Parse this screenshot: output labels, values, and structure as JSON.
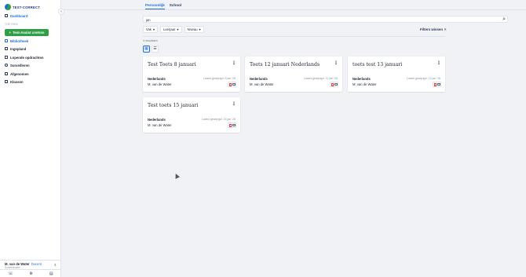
{
  "app": {
    "logo_text": "TEST-CORRECT"
  },
  "sidebar": {
    "collapse_label": "‹",
    "dashboard": "Dashboard",
    "section_label": "TOETSEN",
    "create_button": "Test-Assist creëren",
    "items": [
      {
        "label": "Bibliotheek"
      },
      {
        "label": "Ingepland"
      },
      {
        "label": "Lopende opdrachten"
      },
      {
        "label": "Surveilleren"
      },
      {
        "label": "Afgenomen"
      },
      {
        "label": "Klassen"
      }
    ],
    "user": {
      "name": "M. van de Water",
      "role": "Docent",
      "school": "Scholennaam"
    }
  },
  "tabs": [
    {
      "label": "Persoonlijk"
    },
    {
      "label": "School"
    }
  ],
  "search": {
    "value": "jan"
  },
  "filters": [
    {
      "label": "Vak"
    },
    {
      "label": "Leerjaar"
    },
    {
      "label": "Niveau"
    }
  ],
  "clear_filters": "Filters wissen",
  "results_count": "4 resultaten",
  "cards": [
    {
      "title": "Test Toets 8 januari",
      "subject": "Nederlands",
      "date": "Laatst gewijzigd: 8 jan '26",
      "author": "M. van de Water"
    },
    {
      "title": "Toets 12 januari Nederlands",
      "subject": "Nederlands",
      "date": "Laatst gewijzigd: 12 jan '26",
      "author": "M. van de Water"
    },
    {
      "title": "toets test 13 januari",
      "subject": "Nederlands",
      "date": "Laatst gewijzigd: 13 jan '26",
      "author": "M. van de Water"
    },
    {
      "title": "Test toets 15 januari",
      "subject": "Nederlands",
      "date": "Laatst gewijzigd: 15 jan '26",
      "author": "M. van de Water"
    }
  ],
  "colors": {
    "accent": "#1f6fd1",
    "brand_green": "#2f9e44"
  }
}
